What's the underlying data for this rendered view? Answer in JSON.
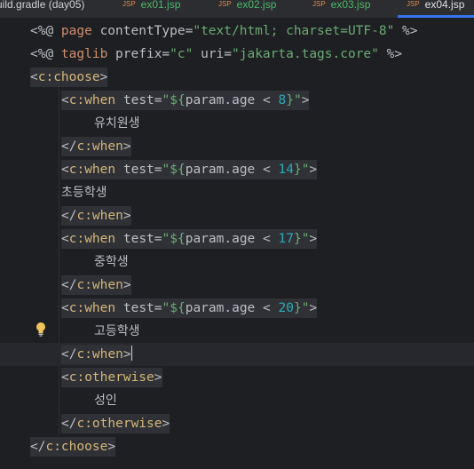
{
  "tabs": [
    {
      "label": "uild.gradle (day05)",
      "type": "gradle"
    },
    {
      "label": "ex01.jsp",
      "type": "jsp"
    },
    {
      "label": "ex02.jsp",
      "type": "jsp"
    },
    {
      "label": "ex03.jsp",
      "type": "jsp"
    },
    {
      "label": "ex04.jsp",
      "type": "jsp",
      "active": true
    }
  ],
  "badge": "JSP",
  "colors": {
    "background": "#1e1f22",
    "tag": "#d5b778",
    "string": "#6aab73",
    "number": "#2aacb8",
    "directive_keyword": "#cf8e6d",
    "active_tab_underline": "#3574f0"
  },
  "code": {
    "l1": {
      "open": "<%@ ",
      "kw": "page",
      "attr": " contentType=",
      "val": "\"text/html; charset=UTF-8\"",
      "close": " %>"
    },
    "l2": {
      "open": "<%@ ",
      "kw": "taglib",
      "attr1": " prefix=",
      "val1": "\"c\"",
      "attr2": " uri=",
      "val2": "\"jakarta.tags.core\"",
      "close": " %>"
    },
    "choose_open": "c:choose",
    "choose_close": "c:choose",
    "when": "c:when",
    "otherwise": "c:otherwise",
    "test_attr": " test=",
    "quote": "\"",
    "expr_open": "${",
    "param": "param.age < ",
    "expr_close": "}",
    "whens": [
      {
        "num": "8",
        "text": "유치원생"
      },
      {
        "num": "14",
        "text": "초등학생"
      },
      {
        "num": "17",
        "text": "중학생"
      },
      {
        "num": "20",
        "text": "고등학생"
      }
    ],
    "otherwise_text": "성인"
  },
  "icons": {
    "intention": "lightbulb-icon"
  }
}
